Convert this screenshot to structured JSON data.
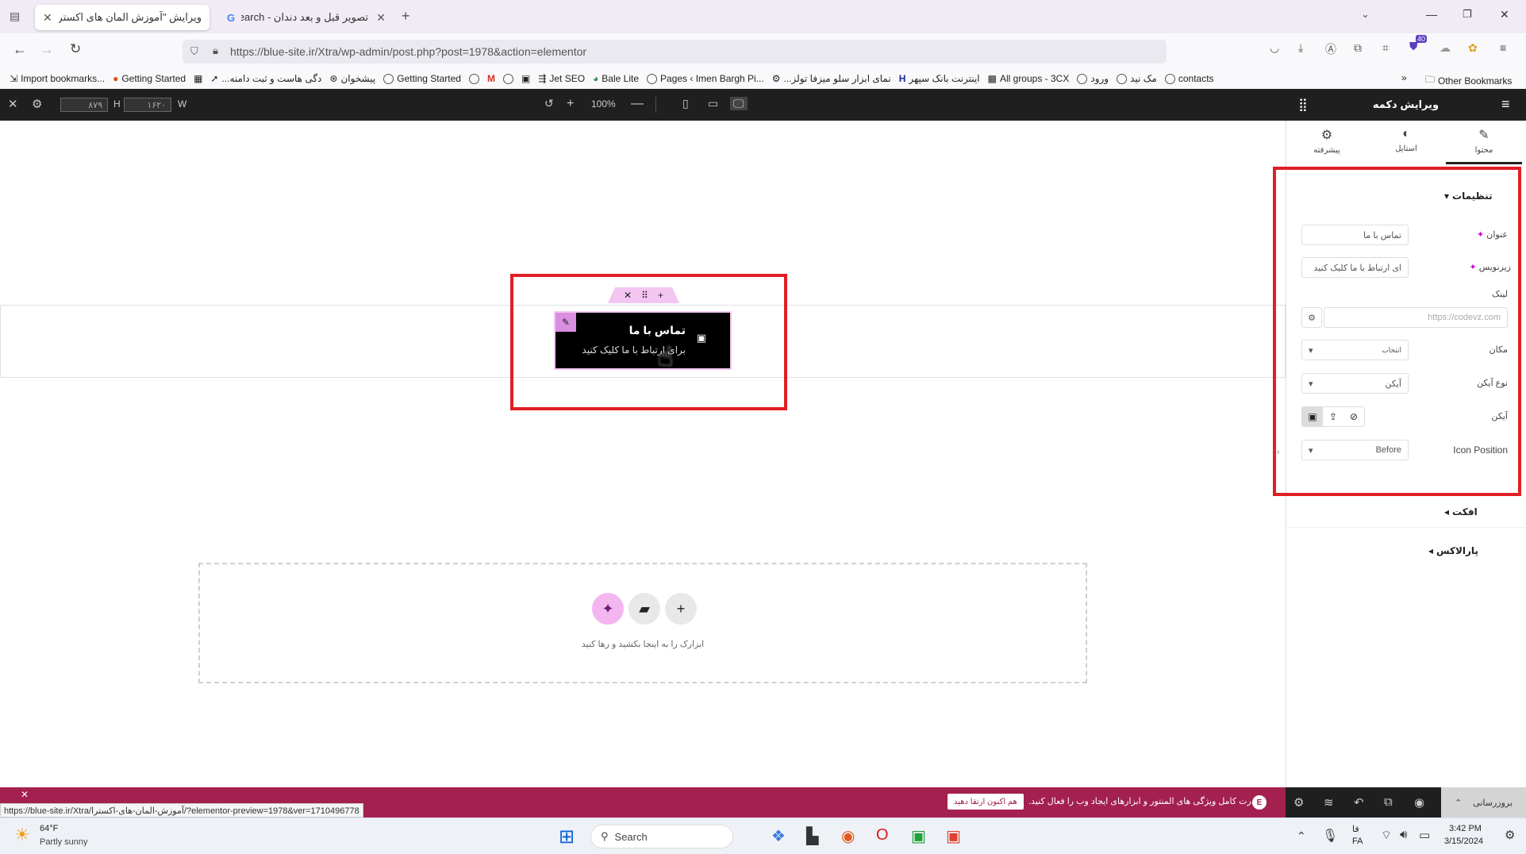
{
  "browser": {
    "tabs": [
      {
        "title": "ویرایش \"آموزش المان های اکسترا –"
      },
      {
        "title": "تصویر قبل و بعد دندان - Search"
      }
    ],
    "url": "https://blue-site.ir/Xtra/wp-admin/post.php?post=1978&action=elementor",
    "extension_badge": "40",
    "bookmarks": [
      "Import bookmarks...",
      "Getting Started",
      "...دگی هاست و ثبت دامنه",
      "پیشخوان",
      "Getting Started",
      "Jet SEO",
      "Bale Lite",
      "Pages ‹ Imen Bargh Pi...",
      "...نمای ابزار سلو میزفا تولز",
      "اینترنت بانک سپهر",
      "All groups - 3CX",
      "ورود",
      "مک نید",
      "contacts"
    ],
    "other_bookmarks": "Other Bookmarks"
  },
  "topbar": {
    "height_value": "۸۷۹",
    "height_label": "H",
    "width_value": "۱۶۲۰",
    "width_label": "W",
    "zoom": "100%"
  },
  "panel": {
    "title": "ویرایش دکمه",
    "tabs": [
      {
        "label": "محتوا",
        "icon": "pencil-icon"
      },
      {
        "label": "استایل",
        "icon": "half-circle-icon"
      },
      {
        "label": "پیشرفته",
        "icon": "gear-icon"
      }
    ],
    "section_settings": "تنظیمات",
    "fields": {
      "title_label": "عنوان",
      "title_value": "تماس با ما",
      "subtitle_label": "زیرنویس",
      "subtitle_value": "ای ارتباط با ما کلیک کنید",
      "link_label": "لینک",
      "link_placeholder": "https://codevz.com",
      "position_label": "مکان",
      "position_value": "انتخاب",
      "icon_type_label": "نوع آیکن",
      "icon_type_value": "آیکن",
      "icon_label": "آیکن",
      "icon_position_label": "Icon Position",
      "icon_position_value": "Before"
    },
    "section_effect": "افکت",
    "section_parallax": "پارالاکس"
  },
  "canvas": {
    "button_title": "تماس با ما",
    "button_subtitle": "برای ارتباط با ما کلیک کنید",
    "drop_text": "ابزارک را به اینجا بکشید و رها کنید"
  },
  "notice": {
    "text": "قدرت کامل ویژگی های المنتور و ابزارهای ایجاد وب را فعال کنید.",
    "button": "هم اکنون ارتقا دهید"
  },
  "panel_footer": {
    "update_label": "بروزرسانی"
  },
  "status_url": "https://blue-site.ir/Xtra/آموزش-المان-های-اکسترا/?elementor-preview=1978&ver=1710496778",
  "taskbar": {
    "weather_temp": "64°F",
    "weather_desc": "Partly sunny",
    "search_placeholder": "Search",
    "lang_top": "فا",
    "lang_bottom": "FA",
    "time": "3:42 PM",
    "date": "3/15/2024"
  },
  "colors": {
    "accent_pink": "#d004d4",
    "highlight_red": "#e01e26",
    "notice_bg": "#a3204f",
    "elementor_dark": "#1f1f1f"
  }
}
